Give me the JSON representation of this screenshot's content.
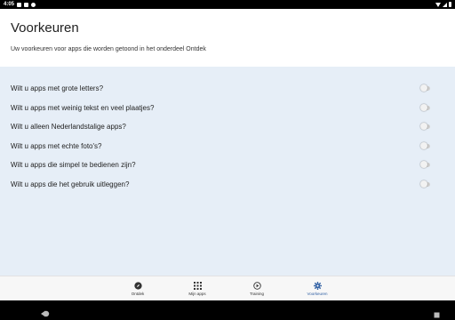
{
  "status_bar": {
    "time": "4:05",
    "left_icons": [
      "notification-icon",
      "sim-icon",
      "sync-icon"
    ],
    "right_icons": [
      "wifi-icon",
      "signal-icon",
      "battery-icon"
    ]
  },
  "header": {
    "title": "Voorkeuren",
    "subtitle": "Uw voorkeuren voor apps die worden getoond in het onderdeel Ontdek"
  },
  "preferences": [
    {
      "label": "Wilt u apps met grote letters?",
      "enabled": false
    },
    {
      "label": "Wilt u apps met weinig tekst en veel plaatjes?",
      "enabled": false
    },
    {
      "label": "Wilt u alleen Nederlandstalige apps?",
      "enabled": false
    },
    {
      "label": "Wilt u apps met echte foto's?",
      "enabled": false
    },
    {
      "label": "Wilt u apps die simpel te bedienen zijn?",
      "enabled": false
    },
    {
      "label": "Wilt u apps die het gebruik uitleggen?",
      "enabled": false
    }
  ],
  "bottom_nav": {
    "items": [
      {
        "label": "Ontdek",
        "icon": "compass-icon",
        "active": false
      },
      {
        "label": "Mijn apps",
        "icon": "grid-icon",
        "active": false
      },
      {
        "label": "Training",
        "icon": "play-circle-icon",
        "active": false
      },
      {
        "label": "Voorkeuren",
        "icon": "gear-icon",
        "active": true
      }
    ]
  },
  "colors": {
    "accent": "#2f5fa3",
    "background": "#e6eef7",
    "header_bg": "#ffffff"
  }
}
